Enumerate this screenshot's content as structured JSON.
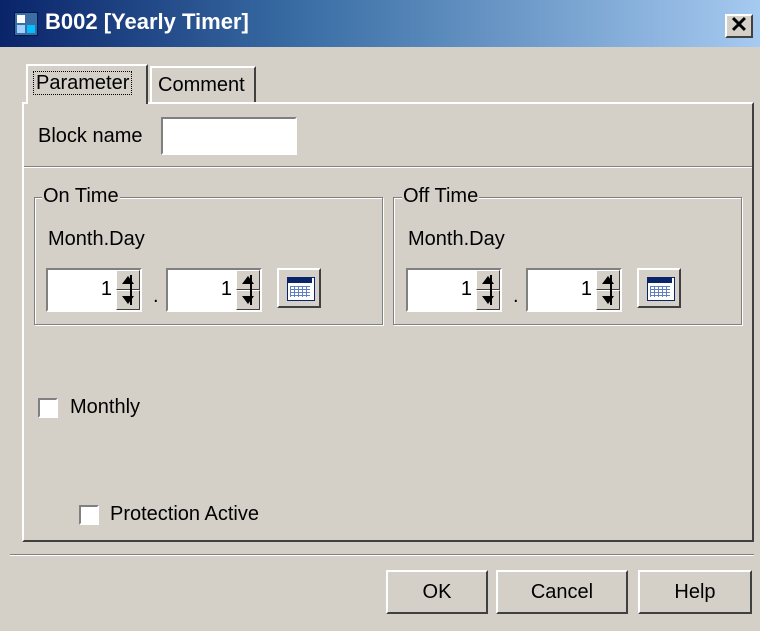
{
  "window": {
    "title": "B002 [Yearly Timer]",
    "close_glyph": "✕"
  },
  "tabs": [
    {
      "label": "Parameter",
      "active": true
    },
    {
      "label": "Comment",
      "active": false
    }
  ],
  "block_name": {
    "label": "Block name",
    "value": ""
  },
  "on_time": {
    "legend": "On Time",
    "field_label": "Month.Day",
    "month": "1",
    "day": "1",
    "separator": "."
  },
  "off_time": {
    "legend": "Off Time",
    "field_label": "Month.Day",
    "month": "1",
    "day": "1",
    "separator": "."
  },
  "monthly": {
    "label": "Monthly",
    "checked": false
  },
  "protection": {
    "label": "Protection Active",
    "checked": false
  },
  "buttons": {
    "ok": "OK",
    "cancel": "Cancel",
    "help": "Help"
  },
  "colors": {
    "titlebar_start": "#0a246a",
    "titlebar_end": "#a6caf0",
    "face": "#d4d0c8"
  },
  "icons": {
    "app": "yearly-timer-app-icon",
    "calendar": "calendar-icon"
  }
}
